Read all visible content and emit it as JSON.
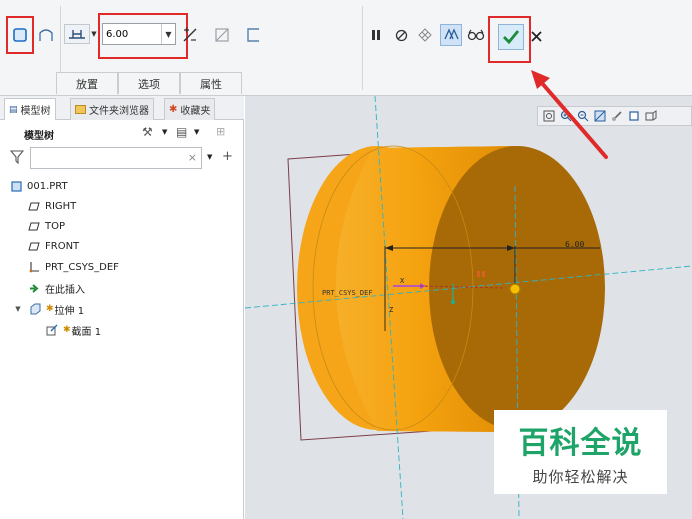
{
  "ribbon": {
    "depth_value": "6.00",
    "tabs": [
      "放置",
      "选项",
      "属性"
    ]
  },
  "panel": {
    "tabs": [
      "模型树",
      "文件夹浏览器",
      "收藏夹"
    ],
    "tree_header": "模型树",
    "filter_placeholder": "",
    "tree": [
      {
        "label": "001.PRT",
        "icon": "part-icon",
        "indent": 0
      },
      {
        "label": "RIGHT",
        "icon": "datum-plane-icon",
        "indent": 1
      },
      {
        "label": "TOP",
        "icon": "datum-plane-icon",
        "indent": 1
      },
      {
        "label": "FRONT",
        "icon": "datum-plane-icon",
        "indent": 1
      },
      {
        "label": "PRT_CSYS_DEF",
        "icon": "coordinate-system-icon",
        "indent": 1
      },
      {
        "label": "在此插入",
        "icon": "insert-here-icon",
        "indent": 1
      },
      {
        "label": "拉伸 1",
        "icon": "extrude-icon",
        "indent": 1
      },
      {
        "label": "截面 1",
        "icon": "sketch-icon",
        "indent": 2
      }
    ]
  },
  "viewport": {
    "dimension_label": "6.00",
    "csys_label": "PRT_CSYS_DEF",
    "axis_x": "X",
    "axis_z": "Z"
  },
  "watermark": {
    "title": "百科全说",
    "subtitle": "助你轻松解决"
  },
  "colors": {
    "solid": "#f5a20f",
    "solid_dark": "#a86a06",
    "highlight_red": "#e02a2a",
    "confirm_green": "#1f8a3a"
  }
}
